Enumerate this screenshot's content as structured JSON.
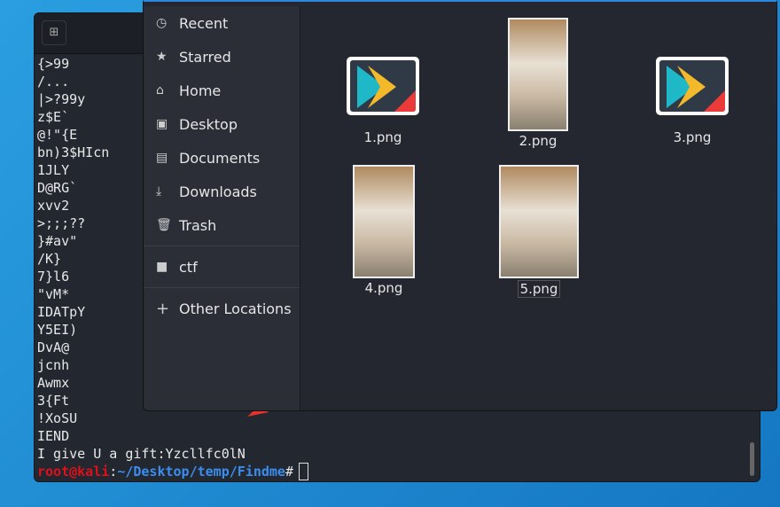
{
  "terminal": {
    "lines": [
      "{>99",
      "/...",
      "|>?99y",
      "z$E`",
      "@!\"{E",
      "bn)3$HIcn",
      "1JLY",
      "D@RG`",
      "xvv2",
      ">;;;??",
      "}#av\"",
      "/K}",
      "7}l6",
      "\"vM*",
      "IDATpY",
      "Y5EI)",
      "DvA@",
      "jcnh",
      "Awmx",
      "3{Ft",
      "!XoSU",
      "IEND",
      "I give U a gift:Yzcllfc0lN"
    ],
    "prompt_user": "root@kali",
    "prompt_sep": ":",
    "prompt_path": "~/Desktop/temp/Findme",
    "prompt_char": "#"
  },
  "file_manager": {
    "sidebar": [
      {
        "label": "Recent",
        "icon": "clock-icon"
      },
      {
        "label": "Starred",
        "icon": "star-icon"
      },
      {
        "label": "Home",
        "icon": "home-icon"
      },
      {
        "label": "Desktop",
        "icon": "desktop-icon"
      },
      {
        "label": "Documents",
        "icon": "document-icon"
      },
      {
        "label": "Downloads",
        "icon": "download-icon"
      },
      {
        "label": "Trash",
        "icon": "trash-icon"
      }
    ],
    "bookmarks": [
      {
        "label": "ctf",
        "icon": "folder-icon"
      }
    ],
    "other": {
      "label": "Other Locations",
      "icon": "plus-icon"
    },
    "files": [
      "1.png",
      "2.png",
      "3.png",
      "4.png",
      "5.png"
    ]
  }
}
